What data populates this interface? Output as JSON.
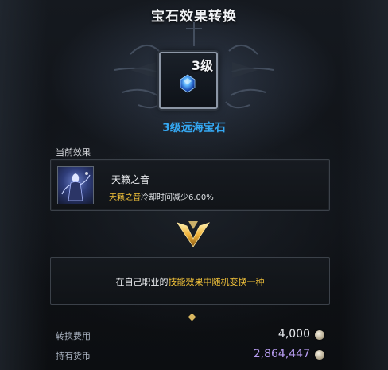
{
  "title": "宝石效果转换",
  "gem": {
    "level_badge": "3级",
    "name": "3级远海宝石"
  },
  "current_effect": {
    "section_label": "当前效果",
    "name": "天籁之音",
    "desc_highlight": "天籁之音",
    "desc_text": "冷却时间减少6.00%"
  },
  "result": {
    "prefix": "在自己职业的",
    "highlight": "技能效果中随机变换一种"
  },
  "cost": {
    "label": "转换费用",
    "value": "4,000"
  },
  "owned": {
    "label": "持有货币",
    "value": "2,864,447"
  },
  "colors": {
    "gem_name": "#35a8f2",
    "highlight": "#f2c23a",
    "cost_value": "#e6e8ec",
    "owned_value": "#b79cf0"
  },
  "icons": {
    "gem": "blue-gem-icon",
    "effect": "celestial-figure-icon",
    "arrow": "gold-down-arrow-icon",
    "coin": "silver-coin-icon"
  }
}
